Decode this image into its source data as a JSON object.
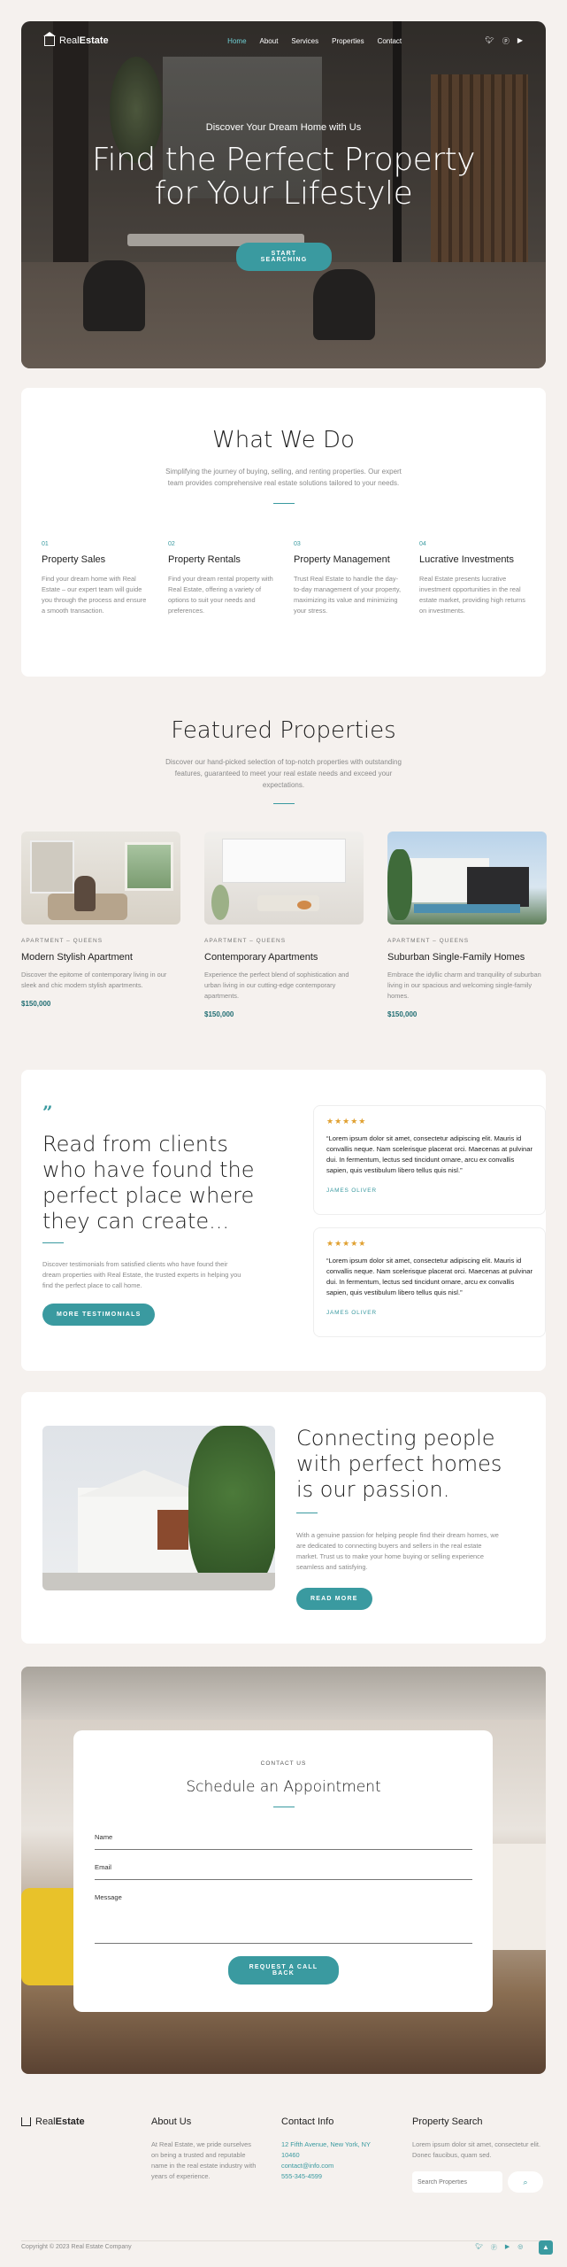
{
  "brand": {
    "name_light": "Real",
    "name_bold": "Estate"
  },
  "nav": {
    "items": [
      "Home",
      "About",
      "Services",
      "Properties",
      "Contact"
    ],
    "active_index": 0
  },
  "hero": {
    "subtitle": "Discover Your Dream Home with Us",
    "title_line1": "Find the Perfect Property",
    "title_line2": "for Your Lifestyle",
    "cta": "START SEARCHING"
  },
  "services": {
    "title": "What We Do",
    "lead": "Simplifying the journey of buying, selling, and renting properties. Our expert team provides comprehensive real estate solutions tailored to your needs.",
    "items": [
      {
        "num": "01",
        "title": "Property Sales",
        "desc": "Find your dream home with Real Estate – our expert team will guide you through the process and ensure a smooth transaction."
      },
      {
        "num": "02",
        "title": "Property Rentals",
        "desc": "Find your dream rental property with Real Estate, offering a variety of options to suit your needs and preferences."
      },
      {
        "num": "03",
        "title": "Property Management",
        "desc": "Trust Real Estate to handle the day-to-day management of your property, maximizing its value and minimizing your stress."
      },
      {
        "num": "04",
        "title": "Lucrative Investments",
        "desc": "Real Estate presents lucrative investment opportunities in the real estate market, providing high returns on investments."
      }
    ]
  },
  "featured": {
    "title": "Featured Properties",
    "lead": "Discover our hand-picked selection of top-notch properties with outstanding features, guaranteed to meet your real estate needs and exceed your expectations.",
    "items": [
      {
        "category": "APARTMENT – QUEENS",
        "title": "Modern Stylish Apartment",
        "desc": "Discover the epitome of contemporary living in our sleek and chic modern stylish apartments.",
        "price": "$150,000"
      },
      {
        "category": "APARTMENT – QUEENS",
        "title": "Contemporary Apartments",
        "desc": "Experience the perfect blend of sophistication and urban living in our cutting-edge contemporary apartments.",
        "price": "$150,000"
      },
      {
        "category": "APARTMENT – QUEENS",
        "title": "Suburban Single-Family Homes",
        "desc": "Embrace the idyllic charm and tranquility of suburban living in our spacious and welcoming single-family homes.",
        "price": "$150,000"
      }
    ]
  },
  "testimonials": {
    "title_lines": [
      "Read from clients",
      "who have found the",
      "perfect place where",
      "they can create..."
    ],
    "lead": "Discover testimonials from satisfied clients who have found their dream properties with Real Estate, the trusted experts in helping you find the perfect place to call home.",
    "cta": "MORE TESTIMONIALS",
    "items": [
      {
        "stars": "★★★★★",
        "quote": "“Lorem ipsum dolor sit amet, consectetur adipiscing elit. Mauris id convallis neque. Nam scelerisque placerat orci. Maecenas at pulvinar dui. In fermentum, lectus sed tincidunt ornare, arcu ex convallis sapien, quis vestibulum libero tellus quis nisl.”",
        "author": "JAMES OLIVER"
      },
      {
        "stars": "★★★★★",
        "quote": "“Lorem ipsum dolor sit amet, consectetur adipiscing elit. Mauris id convallis neque. Nam scelerisque placerat orci. Maecenas at pulvinar dui. In fermentum, lectus sed tincidunt ornare, arcu ex convallis sapien, quis vestibulum libero tellus quis nisl.”",
        "author": "JAMES OLIVER"
      }
    ]
  },
  "passion": {
    "title_lines": [
      "Connecting people",
      "with perfect homes",
      "is our passion."
    ],
    "desc": "With a genuine passion for helping people find their dream homes, we are dedicated to connecting buyers and sellers in the real estate market. Trust us to make your home buying or selling experience seamless and satisfying.",
    "cta": "READ MORE"
  },
  "contact": {
    "eyebrow": "CONTACT US",
    "title": "Schedule an Appointment",
    "name_label": "Name",
    "email_label": "Email",
    "message_label": "Message",
    "cta": "REQUEST A CALL BACK"
  },
  "footer": {
    "about": {
      "title": "About Us",
      "text": "At Real Estate, we pride ourselves on being a trusted and reputable name in the real estate industry with years of experience."
    },
    "info": {
      "title": "Contact Info",
      "lines": [
        "12 Fifth Avenue, New York, NY",
        "10460",
        "contact@info.com",
        "555-345-4599"
      ]
    },
    "search": {
      "title": "Property Search",
      "text": "Lorem ipsum dolor sit amet, consectetur elit. Donec faucibus, quam sed.",
      "placeholder": "Search Properties"
    },
    "copyright": "Copyright © 2023 Real Estate Company"
  },
  "colors": {
    "accent": "#3a9aa0",
    "background": "#f5f1ee"
  },
  "icons": [
    "twitter-icon",
    "pinterest-icon",
    "youtube-icon",
    "instagram-icon",
    "search-icon",
    "quote-icon",
    "arrow-up-icon"
  ]
}
